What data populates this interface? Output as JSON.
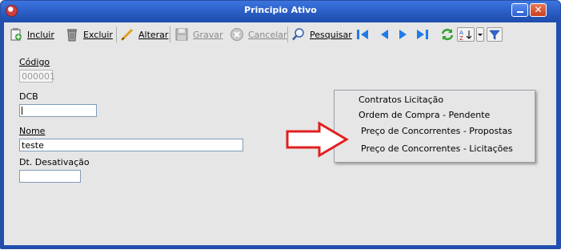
{
  "window": {
    "title": "Principio Ativo"
  },
  "toolbar": {
    "incluir": "Incluir",
    "excluir": "Excluir",
    "alterar": "Alterar",
    "gravar": "Gravar",
    "cancelar": "Cancelar",
    "pesquisar": "Pesquisar",
    "icons": [
      "add-record-icon",
      "delete-trash-icon",
      "edit-pencil-icon",
      "save-floppy-icon",
      "cancel-icon",
      "search-magnifier-icon",
      "first-record-icon",
      "prev-record-icon",
      "next-record-icon",
      "last-record-icon",
      "refresh-icon",
      "sort-icon",
      "dropdown-icon",
      "filter-icon"
    ]
  },
  "form": {
    "codigo_label": "Código",
    "codigo_value": "000001",
    "dcb_label": "DCB",
    "dcb_value": "",
    "nome_label": "Nome",
    "nome_value": "teste",
    "desativacao_label": "Dt. Desativação",
    "desativacao_value": ""
  },
  "context_menu": {
    "items": [
      "Contratos Licitação",
      "Ordem de Compra - Pendente",
      "Preço de Concorrentes - Propostas",
      "Preço de Concorrentes - Licitações"
    ]
  },
  "colors": {
    "titlebar": "#1f4fb0",
    "panel": "#e6e6e6",
    "arrow": "#e02020",
    "nav": "#1e7be8"
  }
}
